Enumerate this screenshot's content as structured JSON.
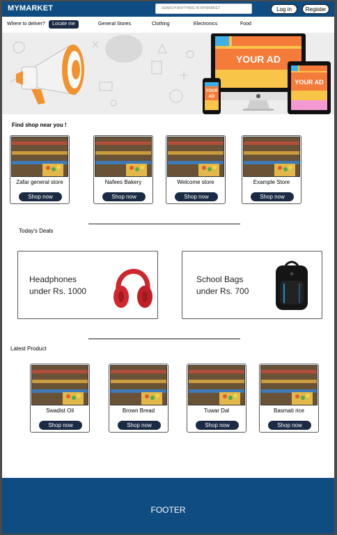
{
  "header": {
    "brand": "MYMARKET",
    "search_placeholder": "SEARCH ANYTHING IN MYMARKET",
    "login_label": "Log in",
    "register_label": "Register"
  },
  "nav": {
    "deliver_label": "Where to deliver?",
    "locate_label": "Locate me",
    "categories": [
      "General Stores",
      "Clothing",
      "Electronics",
      "Food"
    ]
  },
  "banner": {
    "ad_label": "YOUR AD"
  },
  "find_shop": {
    "title": "Find shop near you !",
    "shops": [
      {
        "name": "Zafar general store",
        "button": "Shop now"
      },
      {
        "name": "Nafees Bakery",
        "button": "Shop now"
      },
      {
        "name": "Welcome  store",
        "button": "Shop now"
      },
      {
        "name": "Example Store",
        "button": "Shop now"
      }
    ]
  },
  "deals": {
    "title": "Today's Deals",
    "items": [
      {
        "line1": "Headphones",
        "line2": "under Rs. 1000"
      },
      {
        "line1": "School Bags",
        "line2": "under Rs. 700"
      }
    ]
  },
  "latest": {
    "title": "Latest Product",
    "products": [
      {
        "name": "Swadist Oil",
        "button": "Shop now"
      },
      {
        "name": "Brown Bread",
        "button": "Shop now"
      },
      {
        "name": "Tuwar Dal",
        "button": "Shop now"
      },
      {
        "name": "Basmati rice",
        "button": "Shop now"
      }
    ]
  },
  "footer": {
    "label": "FOOTER"
  },
  "colors": {
    "brand_blue": "#0f4c81",
    "button_navy": "#1c2b45",
    "ad_orange": "#f57b3a",
    "ad_yellow": "#f8c549",
    "ad_cyan": "#3fb0e5"
  }
}
